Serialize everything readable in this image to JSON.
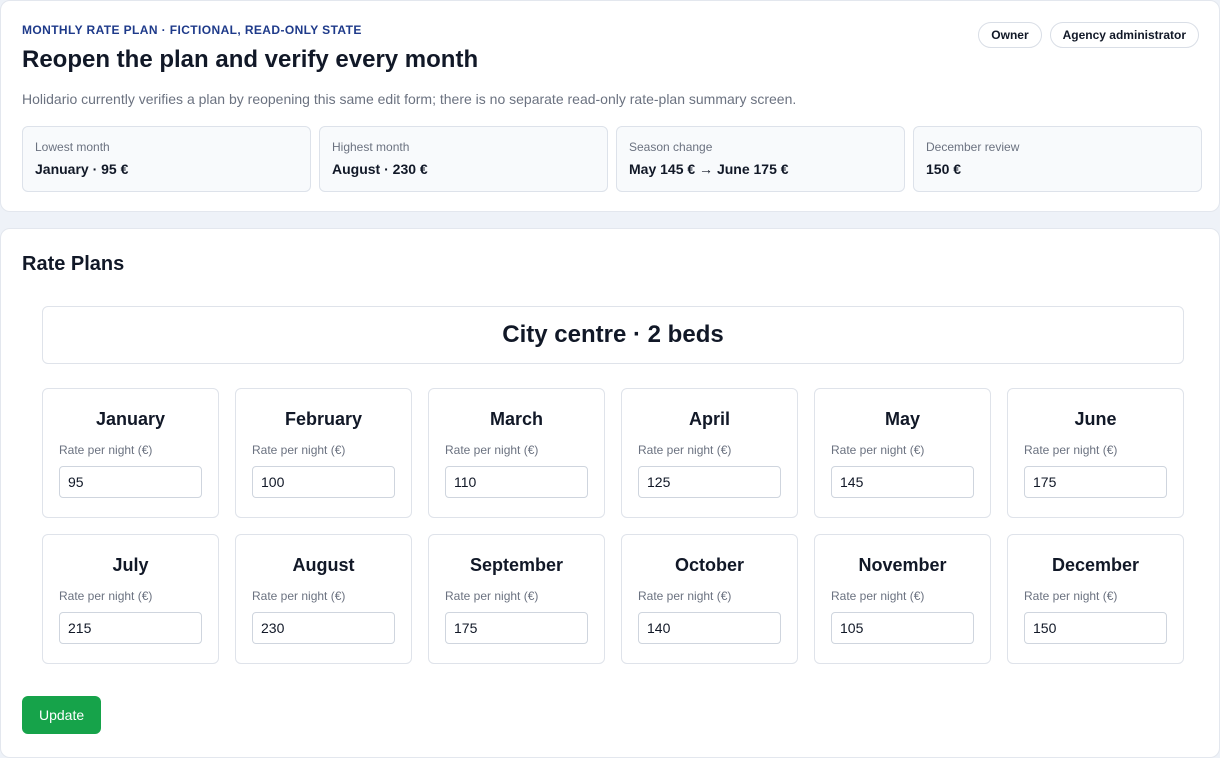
{
  "header": {
    "eyebrow": "MONTHLY RATE PLAN · FICTIONAL, READ-ONLY STATE",
    "title": "Reopen the plan and verify every month",
    "subtitle": "Holidario currently verifies a plan by reopening this same edit form; there is no separate read-only rate-plan summary screen.",
    "roles": [
      "Owner",
      "Agency administrator"
    ]
  },
  "stats": [
    {
      "label": "Lowest month",
      "value": "January · 95 €"
    },
    {
      "label": "Highest month",
      "value": "August · 230 €"
    },
    {
      "label": "Season change",
      "value": "May 145 € → June 175 €"
    },
    {
      "label": "December review",
      "value": "150 €"
    }
  ],
  "editor": {
    "section_title": "Rate Plans",
    "plan_name": "City centre · 2 beds",
    "field_label": "Rate per night (€)",
    "months": [
      {
        "name": "January",
        "rate": "95"
      },
      {
        "name": "February",
        "rate": "100"
      },
      {
        "name": "March",
        "rate": "110"
      },
      {
        "name": "April",
        "rate": "125"
      },
      {
        "name": "May",
        "rate": "145"
      },
      {
        "name": "June",
        "rate": "175"
      },
      {
        "name": "July",
        "rate": "215"
      },
      {
        "name": "August",
        "rate": "230"
      },
      {
        "name": "September",
        "rate": "175"
      },
      {
        "name": "October",
        "rate": "140"
      },
      {
        "name": "November",
        "rate": "105"
      },
      {
        "name": "December",
        "rate": "150"
      }
    ],
    "update_label": "Update"
  },
  "colors": {
    "accent_eyebrow": "#1e3a8a",
    "update_button": "#16a34a",
    "page_background": "#eef2f8"
  }
}
